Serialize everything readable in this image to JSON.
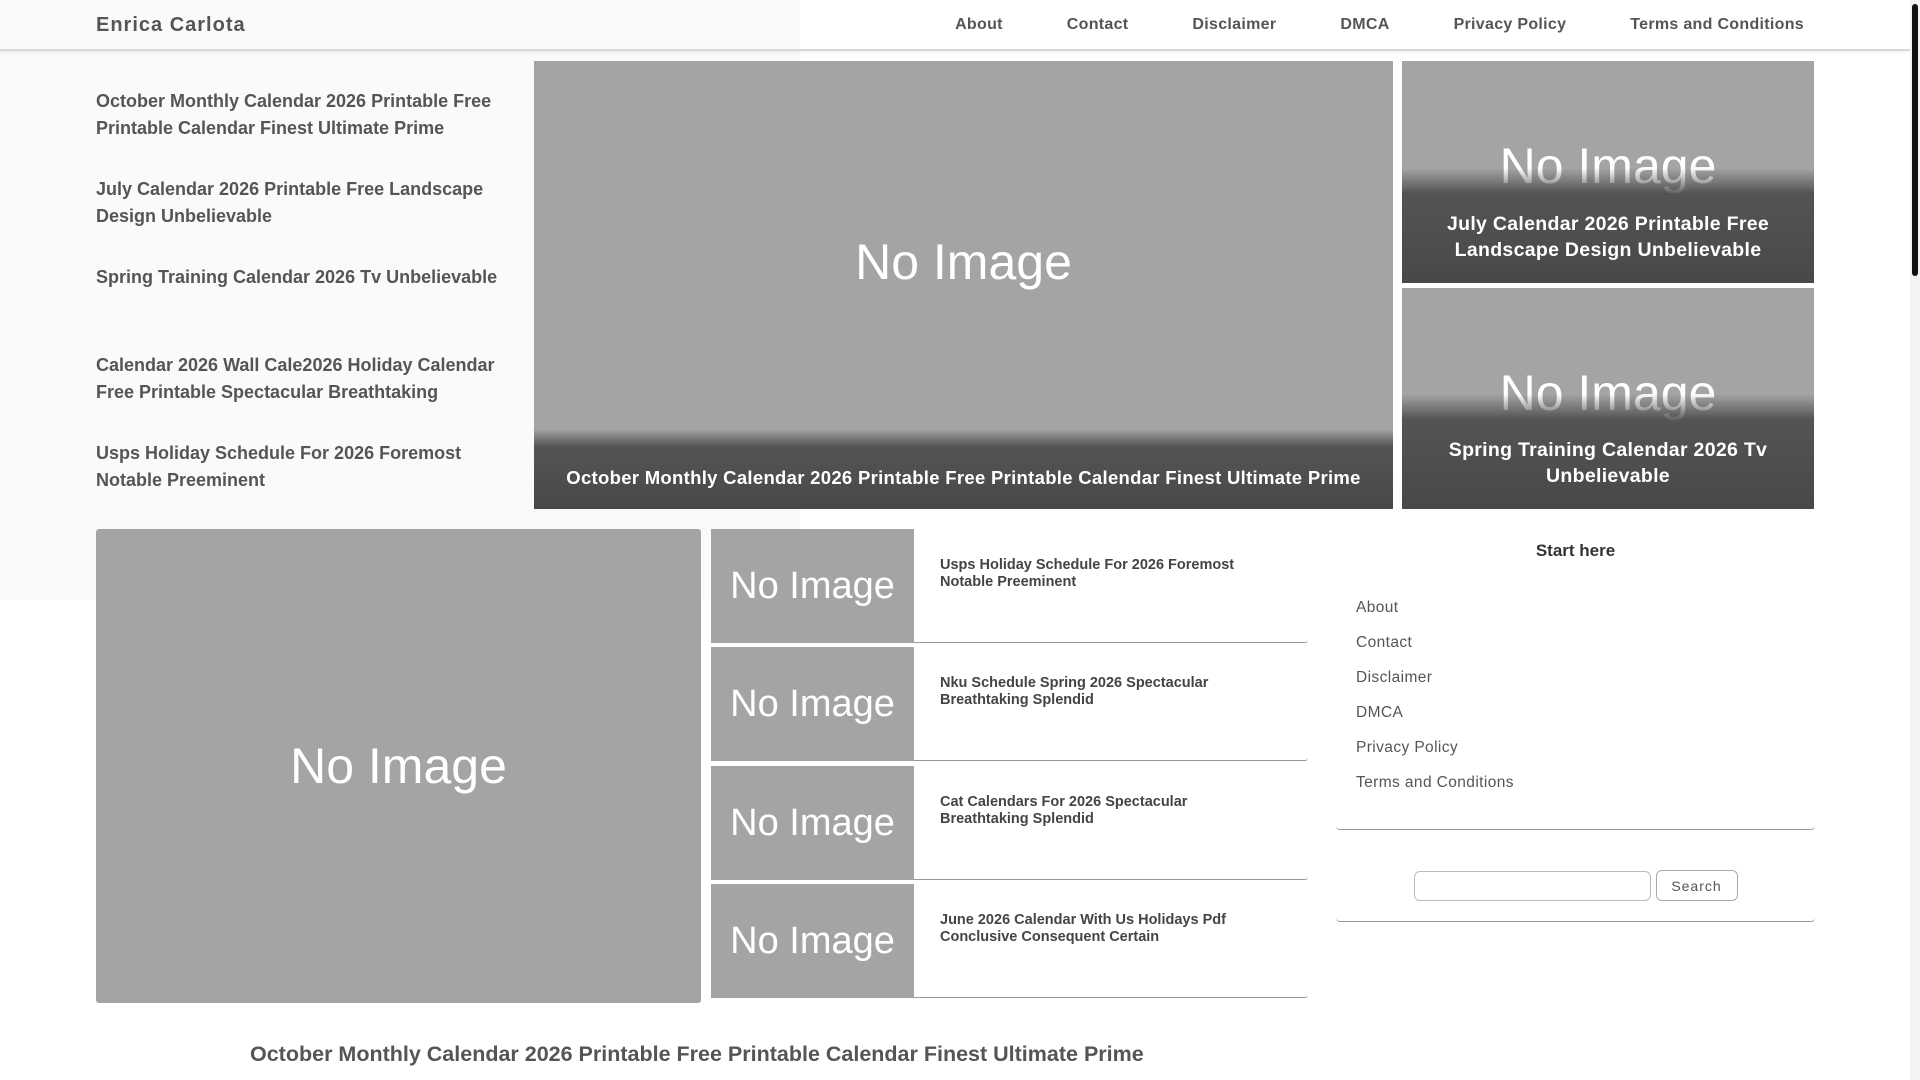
{
  "header": {
    "site_title": "Enrica Carlota",
    "nav": [
      "About",
      "Contact",
      "Disclaimer",
      "DMCA",
      "Privacy Policy",
      "Terms and Conditions"
    ]
  },
  "side_list": [
    "October Monthly Calendar 2026 Printable Free Printable Calendar Finest Ultimate Prime",
    "July Calendar 2026 Printable Free Landscape Design Unbelievable",
    "Spring Training Calendar 2026 Tv Unbelievable",
    "Calendar 2026 Wall Cale2026 Holiday Calendar Free Printable Spectacular Breathtaking",
    "Usps Holiday Schedule For 2026 Foremost Notable Preeminent"
  ],
  "placeholder_text": "No Image",
  "featured": {
    "main_caption": "October Monthly Calendar 2026 Printable Free Printable Calendar Finest Ultimate Prime",
    "side_top_caption": "July Calendar 2026 Printable Free Landscape Design Unbelievable",
    "side_bottom_caption": "Spring Training Calendar 2026 Tv Unbelievable"
  },
  "post_rows": [
    "Usps Holiday Schedule For 2026 Foremost Notable Preeminent",
    "Nku Schedule Spring 2026 Spectacular Breathtaking Splendid",
    "Cat Calendars For 2026 Spectacular Breathtaking Splendid",
    "June 2026 Calendar With Us Holidays Pdf Conclusive Consequent Certain"
  ],
  "sidebar": {
    "heading": "Start here",
    "links": [
      "About",
      "Contact",
      "Disclaimer",
      "DMCA",
      "Privacy Policy",
      "Terms and Conditions"
    ],
    "search": {
      "value": "",
      "button_label": "Search"
    }
  },
  "article": {
    "title": "October Monthly Calendar 2026 Printable Free Printable Calendar Finest Ultimate Prime"
  }
}
